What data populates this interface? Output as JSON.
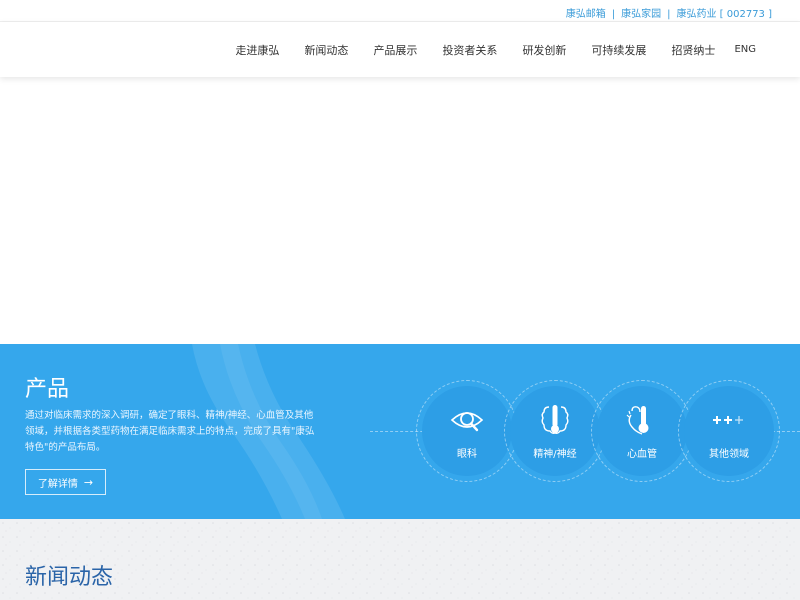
{
  "topbar": {
    "links": [
      "康弘邮箱",
      "康弘家园",
      "康弘药业 [ 002773 ]"
    ],
    "separator": "|"
  },
  "nav": {
    "items": [
      "走进康弘",
      "新闻动态",
      "产品展示",
      "投资者关系",
      "研发创新",
      "可持续发展",
      "招贤纳士"
    ],
    "lang": "ENG"
  },
  "product": {
    "title": "产品",
    "description": "通过对临床需求的深入调研，确定了眼科、精神/神经、心血管及其他领域，并根据各类型药物在满足临床需求上的特点，完成了具有\"康弘特色\"的产品布局。",
    "more_label": "了解详情",
    "more_arrow": "→",
    "categories": [
      {
        "label": "眼科",
        "icon": "eye-search-icon"
      },
      {
        "label": "精神/神经",
        "icon": "brain-thermometer-icon"
      },
      {
        "label": "心血管",
        "icon": "heart-thermometer-icon"
      },
      {
        "label": "其他领域",
        "icon": "plus-plus-icon"
      }
    ]
  },
  "news": {
    "title": "新闻动态"
  },
  "colors": {
    "accent": "#35a7ec",
    "link": "#3a9bd8",
    "news_title": "#2a64a8"
  }
}
